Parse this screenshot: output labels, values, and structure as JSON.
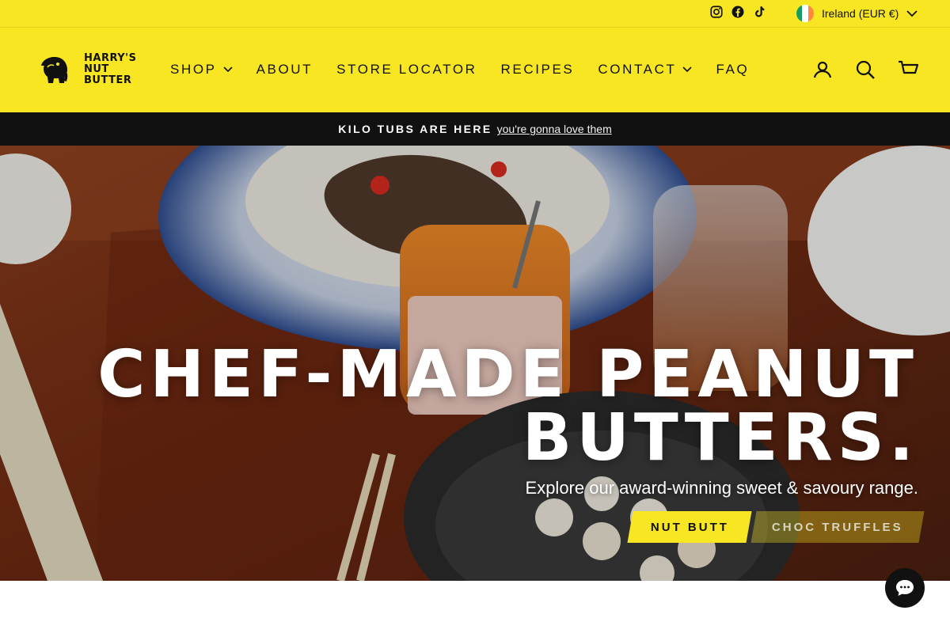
{
  "utility": {
    "region_label": "Ireland (EUR €)"
  },
  "nav": {
    "items": [
      {
        "label": "SHOP",
        "dropdown": true
      },
      {
        "label": "ABOUT"
      },
      {
        "label": "STORE LOCATOR"
      },
      {
        "label": "RECIPES"
      },
      {
        "label": "CONTACT",
        "dropdown": true
      },
      {
        "label": "FAQ"
      }
    ]
  },
  "announcement": {
    "strong": "KILO TUBS ARE HERE",
    "link": "you're gonna love them"
  },
  "hero": {
    "title_line1": "CHEF-MADE PEANUT",
    "title_line2": "BUTTERS.",
    "subtitle": "Explore our award-winning sweet & savoury range.",
    "button_primary": "NUT BUTT",
    "button_secondary": "CHOC TRUFFLES"
  },
  "logo": {
    "line1": "HARRY'S",
    "line2": "NUT",
    "line3": "BUTTER"
  },
  "icons": [
    "instagram-icon",
    "facebook-icon",
    "tiktok-icon",
    "chevron-down-icon",
    "account-icon",
    "search-icon",
    "cart-icon",
    "chat-icon"
  ],
  "colors": {
    "brand_yellow": "#f8e622",
    "dark": "#111111",
    "hero_wood": "#7a3319"
  }
}
